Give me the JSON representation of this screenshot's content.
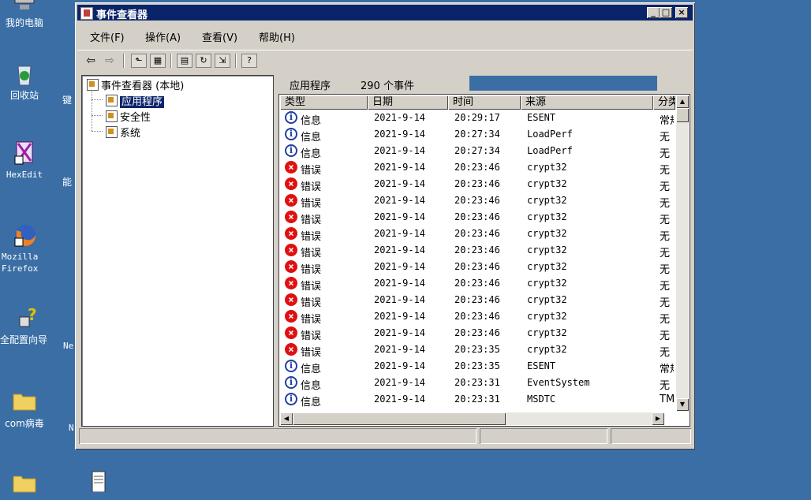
{
  "desktop": {
    "icons": [
      {
        "label": "我的电脑"
      },
      {
        "label": "回收站"
      },
      {
        "label": "HexEdit"
      },
      {
        "label": "Mozilla Firefox"
      },
      {
        "label": "全配置向导"
      },
      {
        "label": "com病毒"
      }
    ],
    "stray": [
      "键",
      "能",
      "Ne",
      "N"
    ]
  },
  "window": {
    "title": "事件查看器",
    "controls": {
      "minimize": "_",
      "maximize": "□",
      "close": "×"
    },
    "menu": [
      "文件(F)",
      "操作(A)",
      "查看(V)",
      "帮助(H)"
    ]
  },
  "tree": {
    "root": "事件查看器 (本地)",
    "items": [
      "应用程序",
      "安全性",
      "系统"
    ],
    "selected": "应用程序"
  },
  "list": {
    "title": "应用程序",
    "count": "290 个事件",
    "columns": [
      "类型",
      "日期",
      "时间",
      "来源",
      "分类"
    ],
    "rows": [
      {
        "icon": "info",
        "type": "信息",
        "date": "2021-9-14",
        "time": "20:29:17",
        "source": "ESENT",
        "cat": "常规"
      },
      {
        "icon": "info",
        "type": "信息",
        "date": "2021-9-14",
        "time": "20:27:34",
        "source": "LoadPerf",
        "cat": "无"
      },
      {
        "icon": "info",
        "type": "信息",
        "date": "2021-9-14",
        "time": "20:27:34",
        "source": "LoadPerf",
        "cat": "无"
      },
      {
        "icon": "error",
        "type": "错误",
        "date": "2021-9-14",
        "time": "20:23:46",
        "source": "crypt32",
        "cat": "无"
      },
      {
        "icon": "error",
        "type": "错误",
        "date": "2021-9-14",
        "time": "20:23:46",
        "source": "crypt32",
        "cat": "无"
      },
      {
        "icon": "error",
        "type": "错误",
        "date": "2021-9-14",
        "time": "20:23:46",
        "source": "crypt32",
        "cat": "无"
      },
      {
        "icon": "error",
        "type": "错误",
        "date": "2021-9-14",
        "time": "20:23:46",
        "source": "crypt32",
        "cat": "无"
      },
      {
        "icon": "error",
        "type": "错误",
        "date": "2021-9-14",
        "time": "20:23:46",
        "source": "crypt32",
        "cat": "无"
      },
      {
        "icon": "error",
        "type": "错误",
        "date": "2021-9-14",
        "time": "20:23:46",
        "source": "crypt32",
        "cat": "无"
      },
      {
        "icon": "error",
        "type": "错误",
        "date": "2021-9-14",
        "time": "20:23:46",
        "source": "crypt32",
        "cat": "无"
      },
      {
        "icon": "error",
        "type": "错误",
        "date": "2021-9-14",
        "time": "20:23:46",
        "source": "crypt32",
        "cat": "无"
      },
      {
        "icon": "error",
        "type": "错误",
        "date": "2021-9-14",
        "time": "20:23:46",
        "source": "crypt32",
        "cat": "无"
      },
      {
        "icon": "error",
        "type": "错误",
        "date": "2021-9-14",
        "time": "20:23:46",
        "source": "crypt32",
        "cat": "无"
      },
      {
        "icon": "error",
        "type": "错误",
        "date": "2021-9-14",
        "time": "20:23:46",
        "source": "crypt32",
        "cat": "无"
      },
      {
        "icon": "error",
        "type": "错误",
        "date": "2021-9-14",
        "time": "20:23:35",
        "source": "crypt32",
        "cat": "无"
      },
      {
        "icon": "info",
        "type": "信息",
        "date": "2021-9-14",
        "time": "20:23:35",
        "source": "ESENT",
        "cat": "常规"
      },
      {
        "icon": "info",
        "type": "信息",
        "date": "2021-9-14",
        "time": "20:23:31",
        "source": "EventSystem",
        "cat": "无"
      },
      {
        "icon": "info",
        "type": "信息",
        "date": "2021-9-14",
        "time": "20:23:31",
        "source": "MSDTC",
        "cat": "TM"
      }
    ]
  },
  "colors": {
    "desktop": "#3a6ea5",
    "titlebar": "#0a246a",
    "error": "#e01010",
    "info": "#2040a0"
  }
}
